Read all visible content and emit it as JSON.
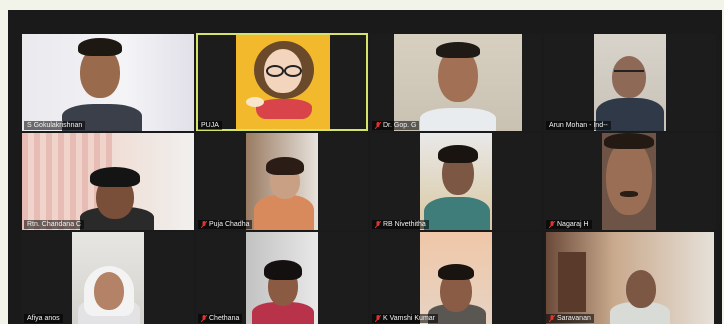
{
  "meeting": {
    "participants": [
      {
        "name": "S Gokulakrishnan",
        "muted": false
      },
      {
        "name": "PUJA",
        "muted": false,
        "active_speaker": true
      },
      {
        "name": "Dr. Gop. G",
        "muted": true
      },
      {
        "name": "Arun Mohan - Ind--",
        "muted": false
      },
      {
        "name": "Rtn. Chandana C",
        "muted": false
      },
      {
        "name": "Puja Chadha",
        "muted": true
      },
      {
        "name": "RB Nivethitha",
        "muted": true
      },
      {
        "name": "Nagaraj H",
        "muted": true
      },
      {
        "name": "Afiya anos",
        "muted": false
      },
      {
        "name": "Chethana",
        "muted": true
      },
      {
        "name": "K Vamshi Kumar",
        "muted": true
      },
      {
        "name": "Saravanan",
        "muted": true
      }
    ],
    "colors": {
      "active_border": "#d6e36a",
      "muted_icon": "#e0322f",
      "background": "#1a1a1a"
    }
  }
}
